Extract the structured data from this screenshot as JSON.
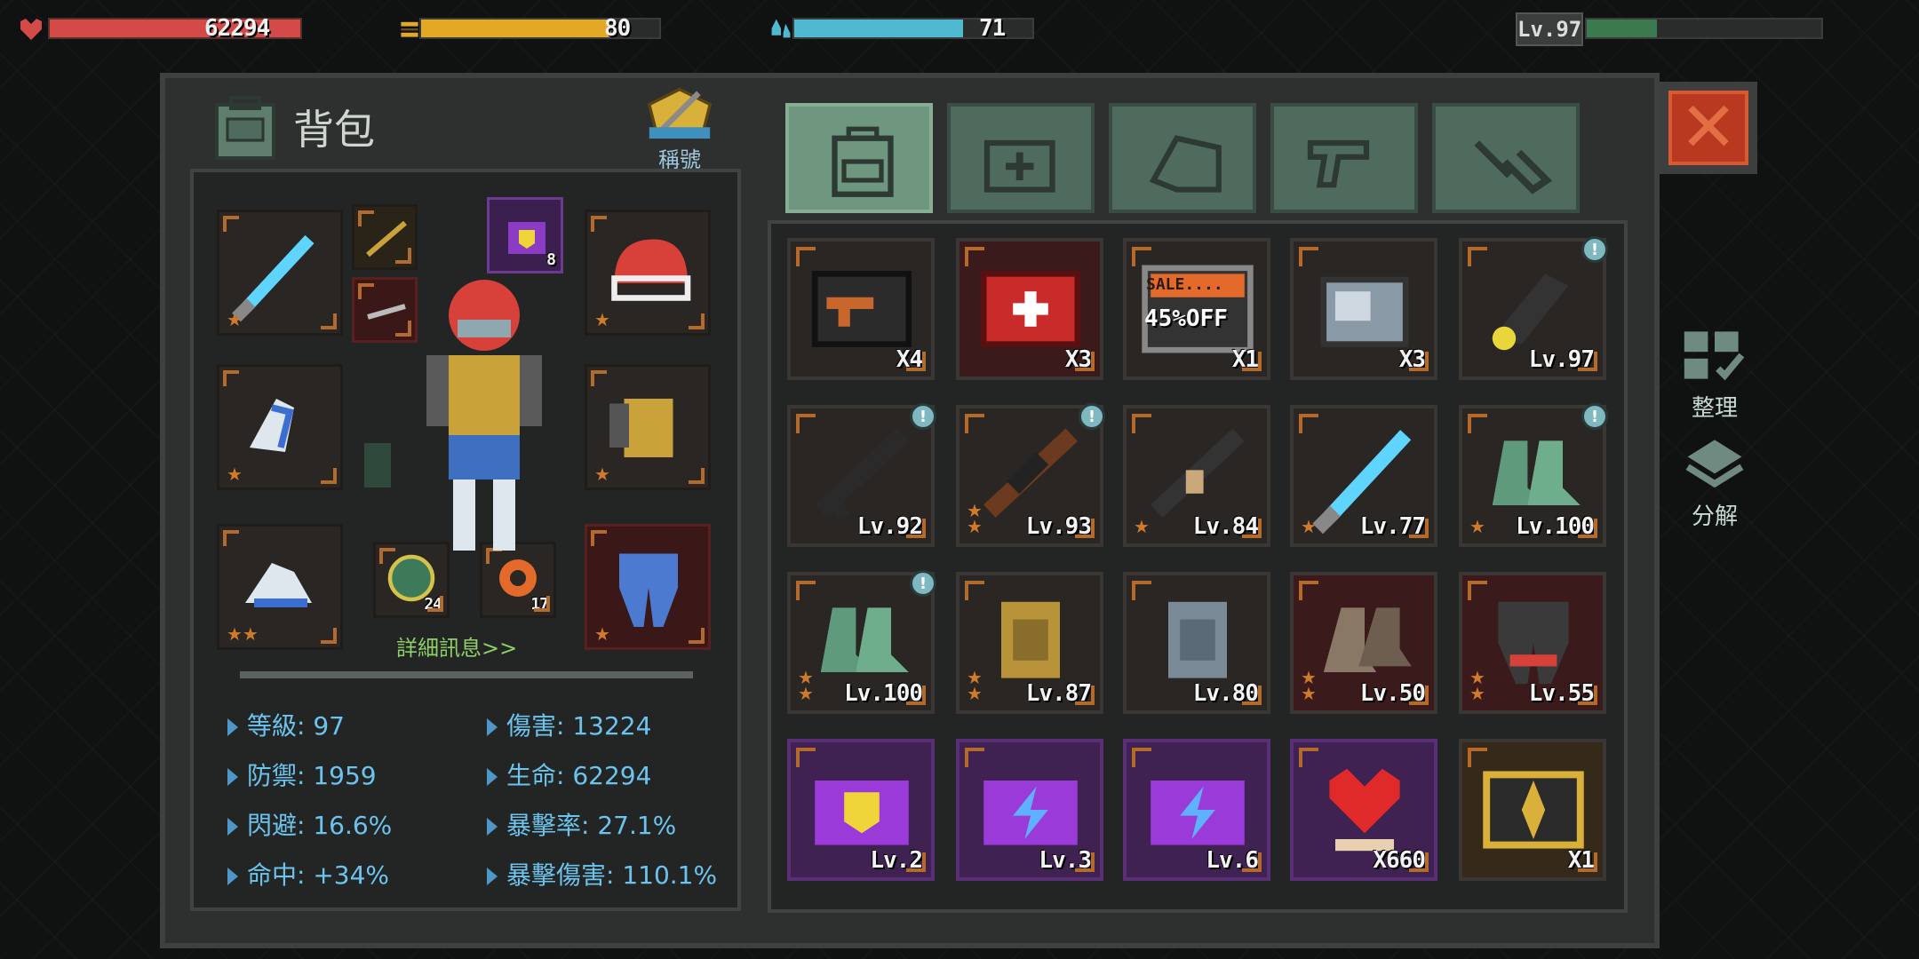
{
  "hud": {
    "hp_value": "62294",
    "hp_fill": 1.0,
    "food_value": "80",
    "food_fill": 0.8,
    "water_value": "71",
    "water_fill": 0.71,
    "level_badge": "Lv.97",
    "xp_fill": 0.3
  },
  "panel": {
    "title": "背包",
    "title_badge_label": "稱號",
    "detail_link": "詳細訊息>>"
  },
  "tabs": [
    {
      "name": "backpack"
    },
    {
      "name": "medical"
    },
    {
      "name": "materials"
    },
    {
      "name": "weapons"
    },
    {
      "name": "tools"
    }
  ],
  "equipment": {
    "bag_count": "8",
    "chip1_count": "24",
    "chip2_count": "17"
  },
  "stats": {
    "level": "等級:  97",
    "damage": "傷害: 13224",
    "defense": "防禦: 1959",
    "hp": "生命: 62294",
    "dodge": "閃避: 16.6%",
    "crit_rate": "暴擊率: 27.1%",
    "accuracy": "命中: +34%",
    "crit_damage": "暴擊傷害: 110.1%"
  },
  "items": [
    {
      "label": "X4",
      "type": "weapon-case",
      "badge": false,
      "stars": 0
    },
    {
      "label": "X3",
      "type": "medkit",
      "badge": false,
      "stars": 0
    },
    {
      "label": "X1",
      "type": "sale-coupon",
      "badge": false,
      "stars": 0,
      "coupon_line1": "SALE....",
      "coupon_line2": "45%OFF"
    },
    {
      "label": "X3",
      "type": "crate",
      "badge": false,
      "stars": 0
    },
    {
      "label": "Lv.97",
      "type": "taser",
      "badge": true,
      "stars": 0
    },
    {
      "label": "Lv.92",
      "type": "rifle",
      "badge": true,
      "stars": 0
    },
    {
      "label": "Lv.93",
      "type": "ak",
      "badge": true,
      "stars": 2
    },
    {
      "label": "Lv.84",
      "type": "smg",
      "badge": false,
      "stars": 1
    },
    {
      "label": "Lv.77",
      "type": "lightsaber",
      "badge": false,
      "stars": 1
    },
    {
      "label": "Lv.100",
      "type": "boots-green",
      "badge": true,
      "stars": 1
    },
    {
      "label": "Lv.100",
      "type": "boots-green",
      "badge": true,
      "stars": 2
    },
    {
      "label": "Lv.87",
      "type": "vest-gold",
      "badge": false,
      "stars": 2
    },
    {
      "label": "Lv.80",
      "type": "vest-gray",
      "badge": false,
      "stars": 0
    },
    {
      "label": "Lv.50",
      "type": "boots-brown",
      "badge": false,
      "stars": 2
    },
    {
      "label": "Lv.55",
      "type": "pants-red",
      "badge": false,
      "stars": 2
    },
    {
      "label": "Lv.2",
      "type": "box-shield",
      "badge": false,
      "stars": 0
    },
    {
      "label": "Lv.3",
      "type": "box-bolt",
      "badge": false,
      "stars": 0
    },
    {
      "label": "Lv.6",
      "type": "box-bolt",
      "badge": false,
      "stars": 0
    },
    {
      "label": "X660",
      "type": "heart",
      "badge": false,
      "stars": 0
    },
    {
      "label": "X1",
      "type": "gold-chest",
      "badge": false,
      "stars": 0
    }
  ],
  "side_buttons": {
    "organize": "整理",
    "disassemble": "分解"
  },
  "colors": {
    "hp": "#d44a48",
    "food": "#e3a926",
    "water": "#4fb9cf",
    "xp": "#3a7a4e",
    "stat_text": "#6cc4ee",
    "link": "#8fcf6a",
    "close": "#b8391f"
  }
}
